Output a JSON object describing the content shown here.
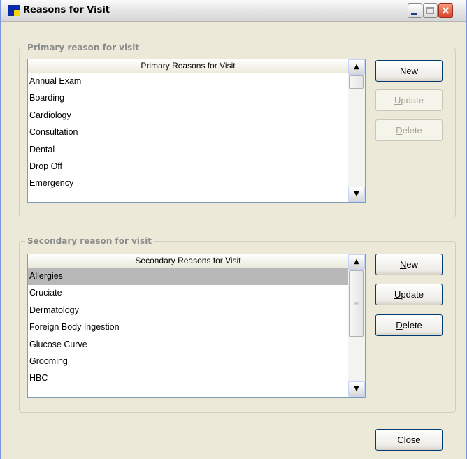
{
  "window": {
    "title": "Reasons for Visit",
    "close_glyph": "×"
  },
  "primary": {
    "group_label": "Primary reason for visit",
    "header": "Primary Reasons for Visit",
    "items": [
      "Annual Exam",
      "Boarding",
      "Cardiology",
      "Consultation",
      "Dental",
      "Drop Off",
      "Emergency"
    ],
    "buttons": {
      "new": {
        "accel": "N",
        "rest": "ew"
      },
      "update": {
        "accel": "U",
        "rest": "pdate"
      },
      "delete": {
        "accel": "D",
        "rest": "elete"
      }
    }
  },
  "secondary": {
    "group_label": "Secondary reason for visit",
    "header": "Secondary Reasons for Visit",
    "items": [
      "Allergies",
      "Cruciate",
      "Dermatology",
      "Foreign Body Ingestion",
      "Glucose Curve",
      "Grooming",
      "HBC"
    ],
    "selected_item": "Allergies",
    "buttons": {
      "new": {
        "accel": "N",
        "rest": "ew"
      },
      "update": {
        "accel": "U",
        "rest": "pdate"
      },
      "delete": {
        "accel": "D",
        "rest": "elete"
      }
    }
  },
  "footer": {
    "close_label": "Close"
  },
  "icons": {
    "scroll_up": "▲",
    "scroll_down": "▼",
    "grip": "≡"
  }
}
